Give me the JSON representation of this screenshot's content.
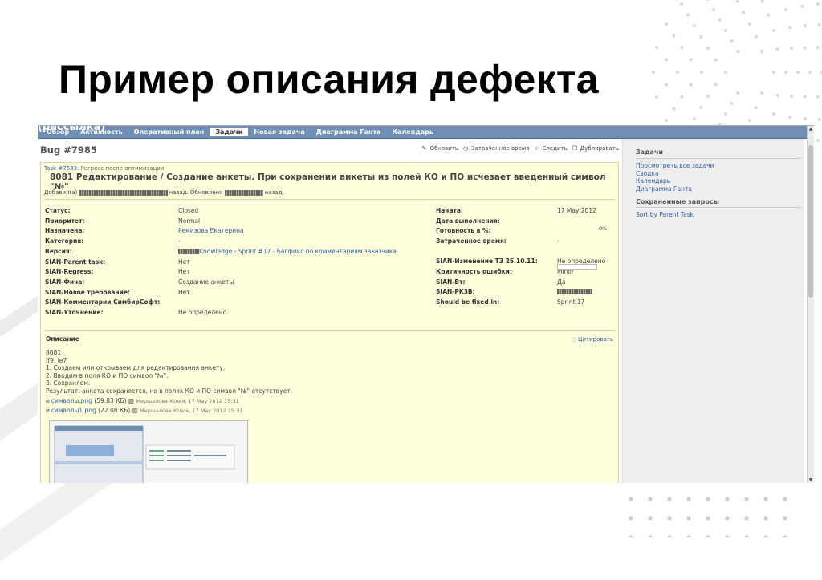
{
  "slide": {
    "title": "Пример описания дефекта"
  },
  "screenshot": {
    "overlay_text": "(рассылка)",
    "tabs": [
      {
        "label": "Обзор"
      },
      {
        "label": "Активность"
      },
      {
        "label": "Оперативный план"
      },
      {
        "label": "Задачи",
        "active": true
      },
      {
        "label": "Новая задача"
      },
      {
        "label": "Диаграмма Ганта"
      },
      {
        "label": "Календарь"
      }
    ],
    "bug_title": "Bug #7985",
    "actions": {
      "update": "Обновить",
      "time": "Затраченное время",
      "watch": "Следить",
      "duplicate": "Дублировать"
    },
    "parent_prefix": "Task #7633",
    "parent_text": ": Регресс после оптимизации",
    "heading": "8081 Редактирование / Создание анкеты. При сохранении анкеты из полей КО и ПО исчезает введенный символ \"№\"",
    "added_prefix": "Добавил(а)",
    "added_mid": "назад. Обновлено",
    "added_suffix": "назад.",
    "fields_left": [
      {
        "label": "Статус:",
        "value": "Closed"
      },
      {
        "label": "Приоритет:",
        "value": "Normal"
      },
      {
        "label": "Назначена:",
        "value": "Ремизова Екатерина",
        "link": true
      },
      {
        "label": "Категория:",
        "value": "-"
      },
      {
        "label": "Версия:",
        "value": "Knowledge - Sprint #17 - Багфикс по комментариям заказчика",
        "link": true
      },
      {
        "label": "SIAN-Parent task:",
        "value": "Нет"
      },
      {
        "label": "SIAN-Regress:",
        "value": "Нет"
      },
      {
        "label": "SIAN-Фича:",
        "value": "Создание анкеты"
      },
      {
        "label": "SIAN-Новое требование:",
        "value": "Нет"
      },
      {
        "label": "SIAN-Комментарии СимбирСофт:",
        "value": ""
      },
      {
        "label": "SIAN-Уточнение:",
        "value": "Не определено"
      }
    ],
    "fields_right": [
      {
        "label": "Начата:",
        "value": "17 May 2012"
      },
      {
        "label": "Дата выполнения:",
        "value": ""
      },
      {
        "label": "Готовность в %:",
        "value": "0%"
      },
      {
        "label": "Затраченное время:",
        "value": "-"
      },
      {
        "label": "SIAN-Изменение ТЗ 25.10.11:",
        "value": "Не определено"
      },
      {
        "label": "Критичность ошибки:",
        "value": "Minor"
      },
      {
        "label": "SIAN-Вт:",
        "value": "Да"
      },
      {
        "label": "SIAN-PK3B:",
        "value": ""
      },
      {
        "label": "Should be fixed in:",
        "value": "Sprint 17"
      }
    ],
    "progress": 0,
    "description_label": "Описание",
    "quote_label": "Цитировать",
    "description_lines": [
      "8081",
      "ff9, ie7",
      "1. Создаем или открываем для редактирования анкету.",
      "2. Вводим в поля КО и ПО символ \"№\".",
      "3. Сохраняем.",
      "Результат: анкета сохраняется, но в полях КО и ПО символ \"№\" отсутствует."
    ],
    "attachments": [
      {
        "file": "символы.png",
        "size": "(59.83 КБ)",
        "meta": "Мершалова Юлия, 17 May 2012 15:31"
      },
      {
        "file": "символы1.png",
        "size": "(22.08 КБ)",
        "meta": "Мершалова Юлия, 17 May 2012 15:31"
      }
    ],
    "sidebar": {
      "tasks_heading": "Задачи",
      "tasks_links": [
        "Просмотреть все задачи",
        "Сводка",
        "Календарь",
        "Диаграмма Ганта"
      ],
      "queries_heading": "Сохраненные запросы",
      "queries_links": [
        "Sort by Parent Task"
      ]
    }
  },
  "colors": {
    "nav": "#6f8fb6",
    "card": "#ffffdd",
    "link": "#3560a6"
  }
}
